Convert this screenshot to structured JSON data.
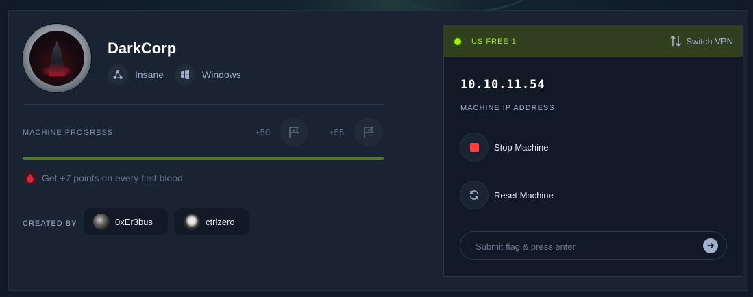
{
  "machine": {
    "name": "DarkCorp",
    "difficulty": "Insane",
    "os": "Windows"
  },
  "progress": {
    "label": "MACHINE PROGRESS",
    "user_points": "+50",
    "root_points": "+55",
    "fraction": 1.0,
    "first_blood_text": "Get +7 points on every first blood"
  },
  "creators": {
    "label": "CREATED BY",
    "items": [
      {
        "name": "0xEr3bus"
      },
      {
        "name": "ctrlzero"
      }
    ]
  },
  "vpn": {
    "server": "US FREE 1",
    "switch_label": "Switch VPN"
  },
  "target": {
    "ip": "10.10.11.54",
    "ip_label": "MACHINE IP ADDRESS"
  },
  "actions": {
    "stop_label": "Stop Machine",
    "reset_label": "Reset Machine"
  },
  "flag": {
    "placeholder": "Submit flag & press enter"
  },
  "colors": {
    "accent": "#9fef00",
    "stop": "#ff3e3e",
    "progress_fill": "#4f7a27",
    "panel_bg": "#111927",
    "card_bg": "#1a2332"
  }
}
